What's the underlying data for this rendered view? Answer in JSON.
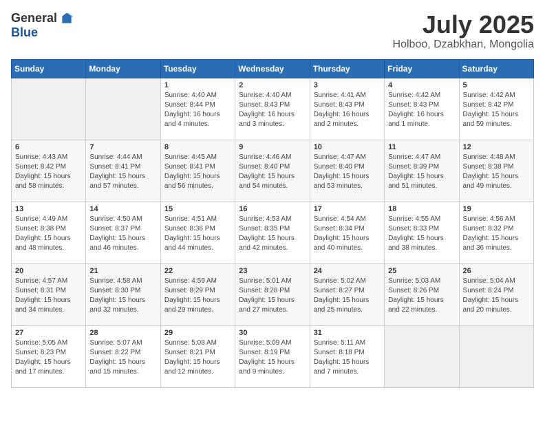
{
  "header": {
    "logo_general": "General",
    "logo_blue": "Blue",
    "month": "July 2025",
    "location": "Holboo, Dzabkhan, Mongolia"
  },
  "weekdays": [
    "Sunday",
    "Monday",
    "Tuesday",
    "Wednesday",
    "Thursday",
    "Friday",
    "Saturday"
  ],
  "weeks": [
    [
      {
        "day": "",
        "empty": true
      },
      {
        "day": "",
        "empty": true
      },
      {
        "day": "1",
        "sunrise": "4:40 AM",
        "sunset": "8:44 PM",
        "daylight": "16 hours and 4 minutes."
      },
      {
        "day": "2",
        "sunrise": "4:40 AM",
        "sunset": "8:43 PM",
        "daylight": "16 hours and 3 minutes."
      },
      {
        "day": "3",
        "sunrise": "4:41 AM",
        "sunset": "8:43 PM",
        "daylight": "16 hours and 2 minutes."
      },
      {
        "day": "4",
        "sunrise": "4:42 AM",
        "sunset": "8:43 PM",
        "daylight": "16 hours and 1 minute."
      },
      {
        "day": "5",
        "sunrise": "4:42 AM",
        "sunset": "8:42 PM",
        "daylight": "15 hours and 59 minutes."
      }
    ],
    [
      {
        "day": "6",
        "sunrise": "4:43 AM",
        "sunset": "8:42 PM",
        "daylight": "15 hours and 58 minutes."
      },
      {
        "day": "7",
        "sunrise": "4:44 AM",
        "sunset": "8:41 PM",
        "daylight": "15 hours and 57 minutes."
      },
      {
        "day": "8",
        "sunrise": "4:45 AM",
        "sunset": "8:41 PM",
        "daylight": "15 hours and 56 minutes."
      },
      {
        "day": "9",
        "sunrise": "4:46 AM",
        "sunset": "8:40 PM",
        "daylight": "15 hours and 54 minutes."
      },
      {
        "day": "10",
        "sunrise": "4:47 AM",
        "sunset": "8:40 PM",
        "daylight": "15 hours and 53 minutes."
      },
      {
        "day": "11",
        "sunrise": "4:47 AM",
        "sunset": "8:39 PM",
        "daylight": "15 hours and 51 minutes."
      },
      {
        "day": "12",
        "sunrise": "4:48 AM",
        "sunset": "8:38 PM",
        "daylight": "15 hours and 49 minutes."
      }
    ],
    [
      {
        "day": "13",
        "sunrise": "4:49 AM",
        "sunset": "8:38 PM",
        "daylight": "15 hours and 48 minutes."
      },
      {
        "day": "14",
        "sunrise": "4:50 AM",
        "sunset": "8:37 PM",
        "daylight": "15 hours and 46 minutes."
      },
      {
        "day": "15",
        "sunrise": "4:51 AM",
        "sunset": "8:36 PM",
        "daylight": "15 hours and 44 minutes."
      },
      {
        "day": "16",
        "sunrise": "4:53 AM",
        "sunset": "8:35 PM",
        "daylight": "15 hours and 42 minutes."
      },
      {
        "day": "17",
        "sunrise": "4:54 AM",
        "sunset": "8:34 PM",
        "daylight": "15 hours and 40 minutes."
      },
      {
        "day": "18",
        "sunrise": "4:55 AM",
        "sunset": "8:33 PM",
        "daylight": "15 hours and 38 minutes."
      },
      {
        "day": "19",
        "sunrise": "4:56 AM",
        "sunset": "8:32 PM",
        "daylight": "15 hours and 36 minutes."
      }
    ],
    [
      {
        "day": "20",
        "sunrise": "4:57 AM",
        "sunset": "8:31 PM",
        "daylight": "15 hours and 34 minutes."
      },
      {
        "day": "21",
        "sunrise": "4:58 AM",
        "sunset": "8:30 PM",
        "daylight": "15 hours and 32 minutes."
      },
      {
        "day": "22",
        "sunrise": "4:59 AM",
        "sunset": "8:29 PM",
        "daylight": "15 hours and 29 minutes."
      },
      {
        "day": "23",
        "sunrise": "5:01 AM",
        "sunset": "8:28 PM",
        "daylight": "15 hours and 27 minutes."
      },
      {
        "day": "24",
        "sunrise": "5:02 AM",
        "sunset": "8:27 PM",
        "daylight": "15 hours and 25 minutes."
      },
      {
        "day": "25",
        "sunrise": "5:03 AM",
        "sunset": "8:26 PM",
        "daylight": "15 hours and 22 minutes."
      },
      {
        "day": "26",
        "sunrise": "5:04 AM",
        "sunset": "8:24 PM",
        "daylight": "15 hours and 20 minutes."
      }
    ],
    [
      {
        "day": "27",
        "sunrise": "5:05 AM",
        "sunset": "8:23 PM",
        "daylight": "15 hours and 17 minutes."
      },
      {
        "day": "28",
        "sunrise": "5:07 AM",
        "sunset": "8:22 PM",
        "daylight": "15 hours and 15 minutes."
      },
      {
        "day": "29",
        "sunrise": "5:08 AM",
        "sunset": "8:21 PM",
        "daylight": "15 hours and 12 minutes."
      },
      {
        "day": "30",
        "sunrise": "5:09 AM",
        "sunset": "8:19 PM",
        "daylight": "15 hours and 9 minutes."
      },
      {
        "day": "31",
        "sunrise": "5:11 AM",
        "sunset": "8:18 PM",
        "daylight": "15 hours and 7 minutes."
      },
      {
        "day": "",
        "empty": true
      },
      {
        "day": "",
        "empty": true
      }
    ]
  ]
}
